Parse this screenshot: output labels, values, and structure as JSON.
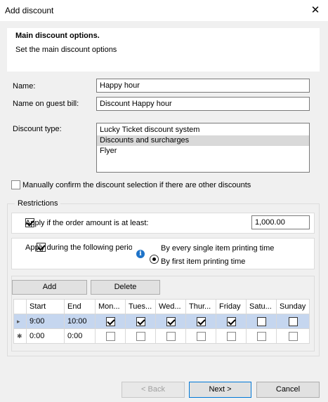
{
  "window": {
    "title": "Add discount"
  },
  "header": {
    "title": "Main discount options.",
    "subtitle": "Set the main discount options"
  },
  "form": {
    "name_label": "Name:",
    "name_value": "Happy hour",
    "guest_bill_label": "Name on guest bill:",
    "guest_bill_value": "Discount Happy hour",
    "discount_type_label": "Discount type:",
    "discount_types": [
      "Lucky Ticket discount system",
      "Discounts and surcharges",
      "Flyer"
    ],
    "discount_type_selected": "Discounts and surcharges",
    "manual_confirm_label": "Manually confirm the discount selection if there are other discounts",
    "manual_confirm_checked": false
  },
  "restrictions": {
    "group_label": "Restrictions",
    "min_amount_label": "Apply if the order amount is at least:",
    "min_amount_checked": true,
    "min_amount_value": "1,000.00",
    "period_label": "Apply during the following perio",
    "period_checked": true,
    "radio_options": [
      "By every single item printing time",
      "By first item printing time"
    ],
    "radio_selected": "By every single item printing time",
    "add_label": "Add",
    "delete_label": "Delete",
    "grid": {
      "columns": [
        "Start",
        "End",
        "Mon...",
        "Tues...",
        "Wed...",
        "Thur...",
        "Friday",
        "Satu...",
        "Sunday"
      ],
      "rows": [
        {
          "marker": "▸",
          "start": "9:00",
          "end": "10:00",
          "days": [
            true,
            true,
            true,
            true,
            true,
            false,
            false
          ],
          "selected": true
        },
        {
          "marker": "✱",
          "start": "0:00",
          "end": "0:00",
          "days": [
            false,
            false,
            false,
            false,
            false,
            false,
            false
          ],
          "selected": false
        }
      ]
    }
  },
  "footer": {
    "back_label": "< Back",
    "next_label": "Next >",
    "cancel_label": "Cancel"
  }
}
